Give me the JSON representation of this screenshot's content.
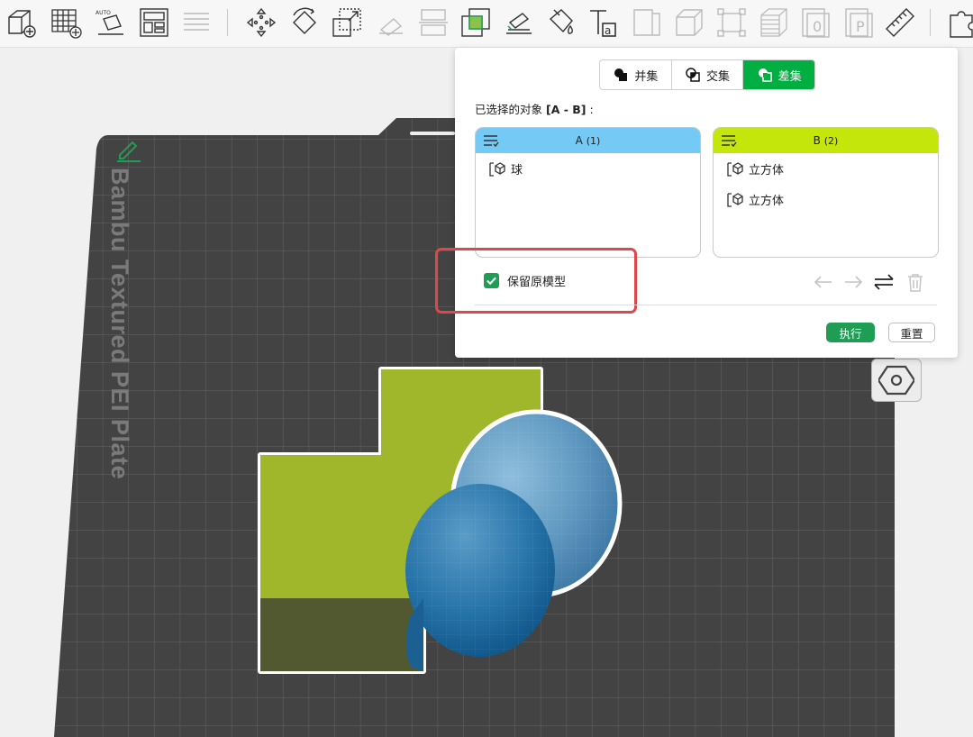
{
  "toolbar": {
    "icons": [
      "add-cube-icon",
      "add-plate-icon",
      "auto-orient-icon",
      "arrange-icon",
      "layers-icon",
      "move-icon",
      "rotate-icon",
      "scale-icon",
      "lay-on-face-icon",
      "cut-icon",
      "boolean-icon",
      "support-paint-icon",
      "color-paint-icon",
      "text-icon",
      "measure-box-icon",
      "assembly-icon",
      "fit-icon",
      "variable-layer-icon",
      "zero-icon",
      "p-icon",
      "ruler-icon",
      "puzzle-icon"
    ]
  },
  "viewport": {
    "plate_label": "Bambu Textured PEI Plate",
    "colors": {
      "plate": "#434343",
      "grid": "#5d5d5d",
      "cube_top": "#a0b62b",
      "cube_side": "#52582f",
      "sphere": "#3d86b4"
    }
  },
  "boolean_panel": {
    "modes": [
      {
        "label": "并集",
        "icon": "union-icon",
        "active": false
      },
      {
        "label": "交集",
        "icon": "intersection-icon",
        "active": false
      },
      {
        "label": "差集",
        "icon": "difference-icon",
        "active": true
      }
    ],
    "selected_objects_label": "已选择的对象",
    "selected_objects_expr": "[A - B]",
    "selected_objects_colon": ":",
    "list_a": {
      "title": "A",
      "count": "(1)",
      "header_color": "#74c9f5",
      "items": [
        "球"
      ]
    },
    "list_b": {
      "title": "B",
      "count": "(2)",
      "header_color": "#c5e60b",
      "items": [
        "立方体",
        "立方体"
      ]
    },
    "keep_original_label": "保留原模型",
    "keep_original_checked": true,
    "execute_label": "执行",
    "reset_label": "重置",
    "accent_color": "#1f9d55"
  }
}
